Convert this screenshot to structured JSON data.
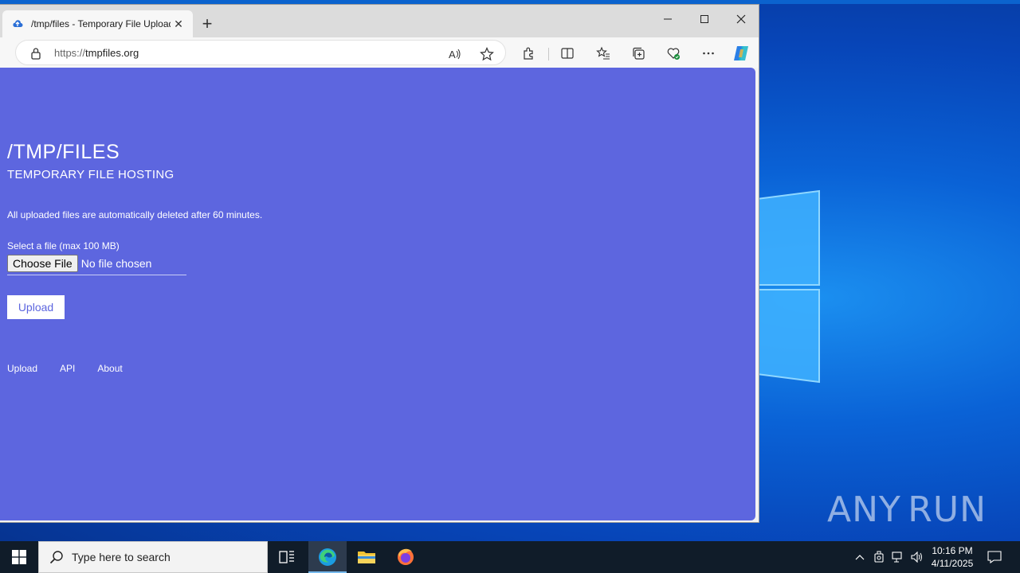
{
  "browser": {
    "tab_title": "/tmp/files - Temporary File Upload",
    "url_protocol": "https://",
    "url_host": "tmpfiles.org",
    "accent": "#0b63ce"
  },
  "page": {
    "background": "#5d66df",
    "title": "/TMP/FILES",
    "subtitle": "TEMPORARY FILE HOSTING",
    "note": "All uploaded files are automatically deleted after 60 minutes.",
    "file_label": "Select a file (max 100 MB)",
    "choose_file": "Choose File",
    "no_file": "No file chosen",
    "upload_button": "Upload",
    "footer_links": [
      "Upload",
      "API",
      "About"
    ]
  },
  "taskbar": {
    "search_placeholder": "Type here to search",
    "time": "10:16 PM",
    "date": "4/11/2025",
    "pinned_apps": [
      "task-view",
      "edge",
      "file-explorer",
      "firefox"
    ]
  },
  "watermark": {
    "left": "ANY",
    "right": "RUN"
  }
}
